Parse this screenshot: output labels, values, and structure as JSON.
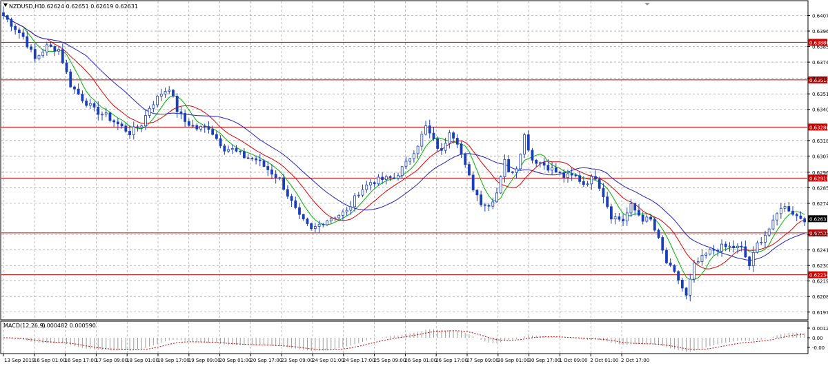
{
  "header": {
    "symbol": "NZDUSD,H1",
    "quote": "0.62624 0.62651 0.62619 0.62631"
  },
  "macd": {
    "label": "MACD(12,26,9)",
    "values": "0.000482 0.000590",
    "ticks": [
      "0.00122",
      "0.00",
      "-0.00"
    ]
  },
  "chart_data": {
    "type": "candlestick",
    "instrument": "NZDUSD",
    "timeframe": "H1",
    "y_ticks": [
      "0.64070",
      "0.63960",
      "0.63850",
      "0.63740",
      "0.63625",
      "0.63515",
      "0.63405",
      "0.63185",
      "0.63075",
      "0.62960",
      "0.62850",
      "0.62740",
      "0.62520",
      "0.62410",
      "0.62300",
      "0.62190",
      "0.62080",
      "0.61970"
    ],
    "x_ticks": [
      "13 Sep 2019",
      "16 Sep 01:00",
      "16 Sep 17:00",
      "17 Sep 09:00",
      "18 Sep 01:00",
      "18 Sep 17:00",
      "19 Sep 09:00",
      "20 Sep 01:00",
      "20 Sep 17:00",
      "23 Sep 09:00",
      "24 Sep 01:00",
      "24 Sep 17:00",
      "25 Sep 09:00",
      "26 Sep 01:00",
      "26 Sep 17:00",
      "27 Sep 09:00",
      "30 Sep 01:00",
      "30 Sep 17:00",
      "1 Oct 09:00",
      "2 Oct 01:00",
      "2 Oct 17:00"
    ],
    "levels": [
      {
        "price": "0.63880",
        "value": 0.6388
      },
      {
        "price": "0.63614",
        "value": 0.63614
      },
      {
        "price": "0.63280",
        "value": 0.6328
      },
      {
        "price": "0.62919",
        "value": 0.62919
      },
      {
        "price": "0.62531",
        "value": 0.62531
      },
      {
        "price": "0.62234",
        "value": 0.62234
      }
    ],
    "current_price": {
      "label": "0.62631",
      "value": 0.62631
    },
    "ylim": [
      0.6192,
      0.6417
    ],
    "price_path": [
      [
        0,
        0.6407
      ],
      [
        2,
        0.6401
      ],
      [
        5,
        0.6392
      ],
      [
        8,
        0.6376
      ],
      [
        11,
        0.6385
      ],
      [
        14,
        0.6383
      ],
      [
        17,
        0.6358
      ],
      [
        20,
        0.6348
      ],
      [
        23,
        0.634
      ],
      [
        26,
        0.6336
      ],
      [
        29,
        0.633
      ],
      [
        32,
        0.6324
      ],
      [
        35,
        0.633
      ],
      [
        37,
        0.6342
      ],
      [
        40,
        0.6352
      ],
      [
        42,
        0.6356
      ],
      [
        44,
        0.634
      ],
      [
        46,
        0.6332
      ],
      [
        49,
        0.6327
      ],
      [
        52,
        0.6328
      ],
      [
        54,
        0.632
      ],
      [
        56,
        0.6313
      ],
      [
        58,
        0.6312
      ],
      [
        61,
        0.6307
      ],
      [
        64,
        0.6305
      ],
      [
        67,
        0.6298
      ],
      [
        70,
        0.6291
      ],
      [
        72,
        0.628
      ],
      [
        75,
        0.6264
      ],
      [
        78,
        0.6255
      ],
      [
        81,
        0.6261
      ],
      [
        84,
        0.6265
      ],
      [
        87,
        0.6268
      ],
      [
        90,
        0.6282
      ],
      [
        93,
        0.6289
      ],
      [
        96,
        0.6291
      ],
      [
        99,
        0.6292
      ],
      [
        102,
        0.6302
      ],
      [
        105,
        0.6316
      ],
      [
        107,
        0.6328
      ],
      [
        109,
        0.6318
      ],
      [
        111,
        0.631
      ],
      [
        113,
        0.6326
      ],
      [
        115,
        0.6318
      ],
      [
        117,
        0.63
      ],
      [
        119,
        0.6285
      ],
      [
        121,
        0.6275
      ],
      [
        123,
        0.6272
      ],
      [
        125,
        0.6282
      ],
      [
        127,
        0.6306
      ],
      [
        128,
        0.6295
      ],
      [
        130,
        0.63
      ],
      [
        132,
        0.6322
      ],
      [
        134,
        0.6305
      ],
      [
        136,
        0.6303
      ],
      [
        139,
        0.6298
      ],
      [
        142,
        0.6293
      ],
      [
        145,
        0.6293
      ],
      [
        147,
        0.6288
      ],
      [
        150,
        0.6293
      ],
      [
        152,
        0.628
      ],
      [
        154,
        0.6265
      ],
      [
        157,
        0.6262
      ],
      [
        159,
        0.6272
      ],
      [
        162,
        0.6263
      ],
      [
        164,
        0.6262
      ],
      [
        166,
        0.6248
      ],
      [
        168,
        0.6232
      ],
      [
        171,
        0.622
      ],
      [
        173,
        0.6208
      ],
      [
        175,
        0.623
      ],
      [
        177,
        0.6235
      ],
      [
        179,
        0.624
      ],
      [
        182,
        0.6243
      ],
      [
        185,
        0.6243
      ],
      [
        187,
        0.6242
      ],
      [
        189,
        0.623
      ],
      [
        191,
        0.6245
      ],
      [
        193,
        0.6252
      ],
      [
        195,
        0.626
      ],
      [
        197,
        0.6272
      ],
      [
        199,
        0.627
      ],
      [
        201,
        0.6265
      ],
      [
        203,
        0.6263
      ]
    ],
    "moving_averages": [
      {
        "color": "#00b000",
        "period": 6
      },
      {
        "color": "#e00000",
        "period": 12
      },
      {
        "color": "#2020c0",
        "period": 22
      }
    ],
    "colors": {
      "candle": "#1a3fb8",
      "level": "#cc0000",
      "ma_fast": "#00b000",
      "ma_mid": "#e00000",
      "ma_slow": "#2020c0",
      "macd_signal": "#cc0000",
      "macd_hist": "#999999"
    }
  }
}
